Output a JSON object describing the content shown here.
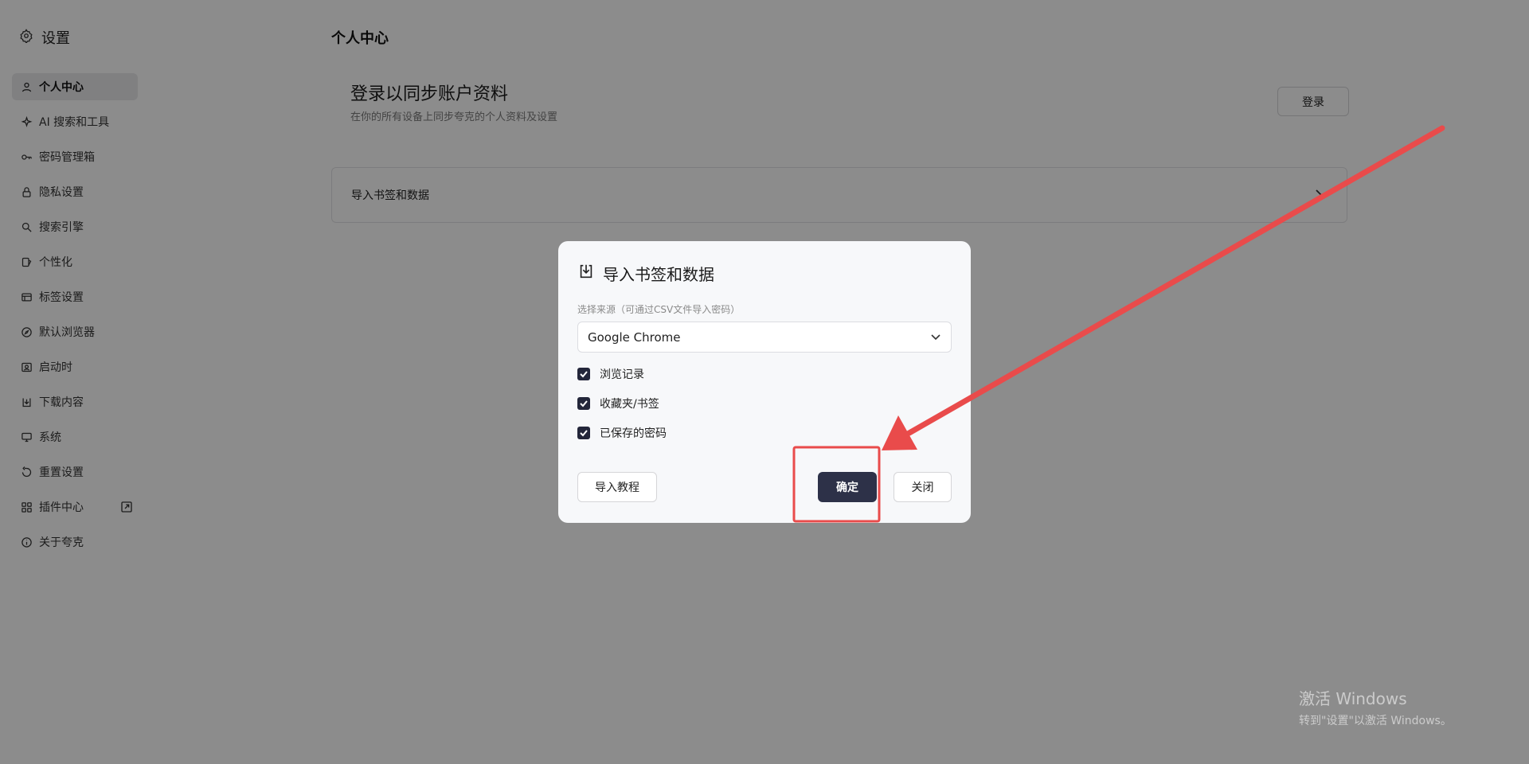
{
  "sidebar": {
    "title": "设置",
    "items": [
      {
        "label": "个人中心",
        "icon": "user-icon",
        "active": true
      },
      {
        "label": "AI 搜索和工具",
        "icon": "sparkle-icon"
      },
      {
        "label": "密码管理箱",
        "icon": "key-icon"
      },
      {
        "label": "隐私设置",
        "icon": "lock-icon"
      },
      {
        "label": "搜索引擎",
        "icon": "search-icon"
      },
      {
        "label": "个性化",
        "icon": "palette-icon"
      },
      {
        "label": "标签设置",
        "icon": "tabs-icon"
      },
      {
        "label": "默认浏览器",
        "icon": "compass-icon"
      },
      {
        "label": "启动时",
        "icon": "startup-icon"
      },
      {
        "label": "下载内容",
        "icon": "download-icon"
      },
      {
        "label": "系统",
        "icon": "monitor-icon"
      },
      {
        "label": "重置设置",
        "icon": "reset-icon"
      },
      {
        "label": "插件中心",
        "icon": "grid-icon"
      },
      {
        "label": "关于夸克",
        "icon": "info-icon"
      }
    ]
  },
  "main": {
    "title": "个人中心",
    "login": {
      "title": "登录以同步账户资料",
      "subtitle": "在你的所有设备上同步夸克的个人资料及设置",
      "button": "登录"
    },
    "import_row": "导入书签和数据"
  },
  "dialog": {
    "title": "导入书签和数据",
    "source_label": "选择来源（可通过CSV文件导入密码）",
    "source_value": "Google Chrome",
    "options": [
      {
        "label": "浏览记录",
        "checked": true
      },
      {
        "label": "收藏夹/书签",
        "checked": true
      },
      {
        "label": "已保存的密码",
        "checked": true
      }
    ],
    "buttons": {
      "tutorial": "导入教程",
      "confirm": "确定",
      "close": "关闭"
    }
  },
  "watermark": {
    "line1": "激活 Windows",
    "line2": "转到\"设置\"以激活 Windows。"
  },
  "colors": {
    "overlay": "rgba(0,0,0,0.45)",
    "primary_button": "#2d3148",
    "annotation": "#e94b4b"
  }
}
